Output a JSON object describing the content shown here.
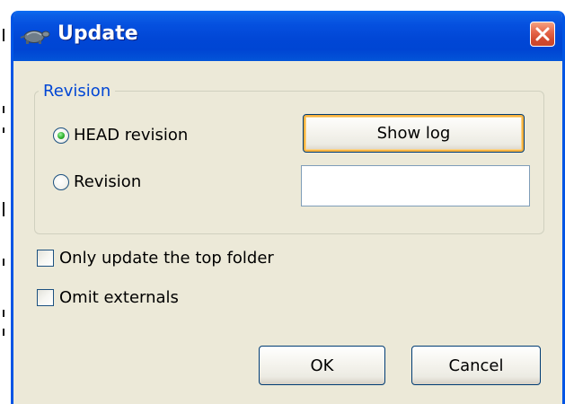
{
  "window": {
    "title": "Update",
    "icon": "tortoise-icon",
    "close_icon": "close-icon"
  },
  "revision_group": {
    "title": "Revision",
    "head_radio": {
      "label": "HEAD revision",
      "selected": true
    },
    "revision_radio": {
      "label": "Revision",
      "selected": false
    },
    "show_log_label": "Show log",
    "revision_input": {
      "value": "",
      "placeholder": ""
    }
  },
  "options": {
    "only_top_folder": {
      "label": "Only update the top folder",
      "checked": false
    },
    "omit_externals": {
      "label": "Omit externals",
      "checked": false
    }
  },
  "buttons": {
    "ok_label": "OK",
    "cancel_label": "Cancel"
  },
  "colors": {
    "titlebar": "#0147d6",
    "frame": "#0055e5",
    "dialog_bg": "#ece9d8",
    "group_title": "#0046d5",
    "close_button": "#d24a2e",
    "radio_selected": "#2fb12f",
    "default_button_highlight": "#f8b33f"
  }
}
